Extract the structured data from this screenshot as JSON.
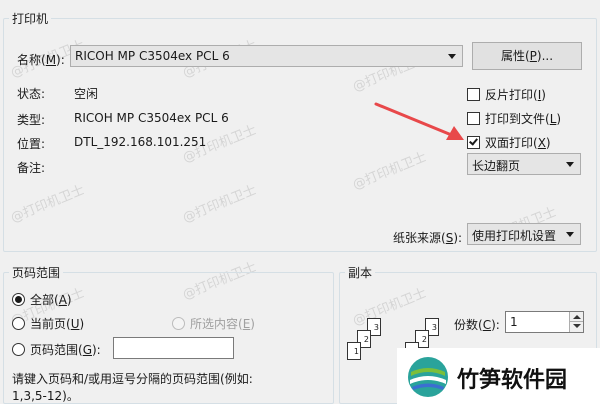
{
  "printer": {
    "group_label": "打印机",
    "name_label": "名称(",
    "name_accel": "M",
    "name_label_end": "):",
    "name_value": "RICOH MP C3504ex PCL 6",
    "properties_label": "属性(",
    "properties_accel": "P",
    "properties_label_end": ")...",
    "status_label": "状态:",
    "status_value": "空闲",
    "type_label": "类型:",
    "type_value": "RICOH MP C3504ex PCL 6",
    "location_label": "位置:",
    "location_value": "DTL_192.168.101.251",
    "comment_label": "备注:",
    "reverse_print_label": "反片打印(",
    "reverse_print_accel": "I",
    "reverse_print_end": ")",
    "reverse_print_checked": false,
    "print_to_file_label": "打印到文件(",
    "print_to_file_accel": "L",
    "print_to_file_end": ")",
    "print_to_file_checked": false,
    "duplex_label": "双面打印(",
    "duplex_accel": "X",
    "duplex_end": ")",
    "duplex_checked": true,
    "duplex_mode_value": "长边翻页",
    "paper_source_label": "纸张来源(",
    "paper_source_accel": "S",
    "paper_source_end": "):",
    "paper_source_value": "使用打印机设置"
  },
  "page_range": {
    "group_label": "页码范围",
    "all_label": "全部(",
    "all_accel": "A",
    "all_end": ")",
    "current_label": "当前页(",
    "current_accel": "U",
    "current_end": ")",
    "selection_label": "所选内容(",
    "selection_accel": "E",
    "selection_end": ")",
    "pages_label": "页码范围(",
    "pages_accel": "G",
    "pages_end": "):",
    "pages_value": "",
    "hint_line1": "请键入页码和/或用逗号分隔的页码范围(例如:",
    "hint_line2": "1,3,5-12)。",
    "selected": "all"
  },
  "copies": {
    "group_label": "副本",
    "count_label": "份数(",
    "count_accel": "C",
    "count_end": "):",
    "count_value": "1",
    "page_numbers": [
      "1",
      "2",
      "3"
    ]
  },
  "watermarks": {
    "text": "@打印机卫士",
    "logo_text": "竹笋软件园"
  },
  "colors": {
    "arrow": "#e8484a",
    "group_border": "#d5dfe5",
    "logo_teal": "#2aa39b",
    "logo_blue": "#3b6fd1",
    "logo_green": "#7bbf3a"
  }
}
